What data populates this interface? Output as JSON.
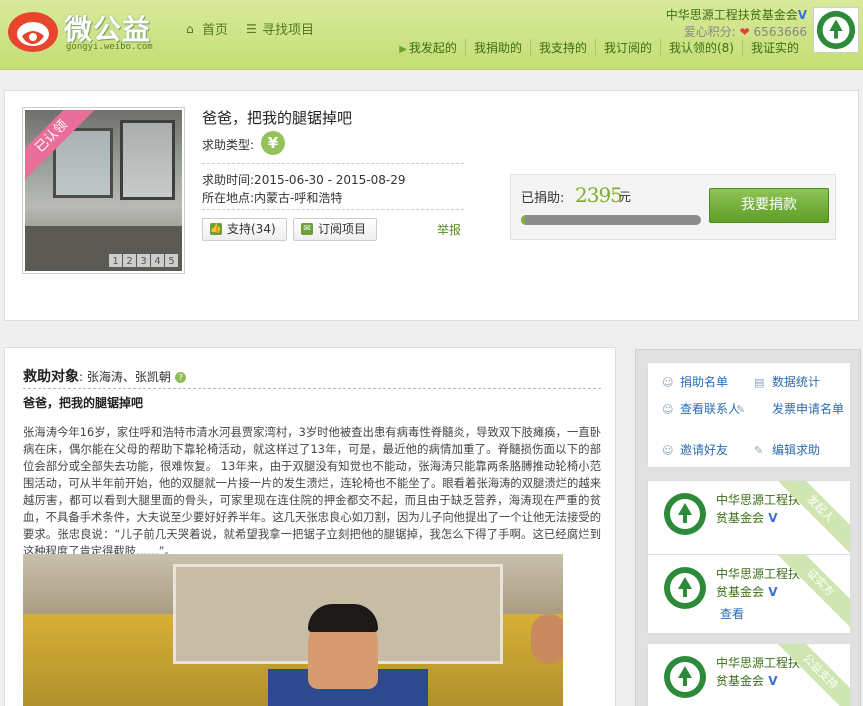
{
  "header": {
    "logo_text": "微公益",
    "logo_sub": "gongyi.weibo.com",
    "nav": [
      {
        "label": "首页",
        "icon": "home-icon"
      },
      {
        "label": "寻找项目",
        "icon": "list-icon"
      }
    ],
    "org_name": "中华思源工程扶贫基金会",
    "verified_mark": "V",
    "score_label": "爱心积分:",
    "score_value": "6563666",
    "subnav": [
      "我发起的",
      "我捐助的",
      "我支持的",
      "我订阅的",
      "我认领的(8)",
      "我证实的"
    ]
  },
  "project": {
    "ribbon": "已认领",
    "pages": [
      "1",
      "2",
      "3",
      "4",
      "5"
    ],
    "title": "爸爸，把我的腿锯掉吧",
    "category_label": "求助类型:",
    "category_icon": "¥",
    "time_label": "求助时间",
    "time_value": ":2015-06-30 - 2015-08-29",
    "place_label": "所在地点",
    "place_value": ":内蒙古-呼和浩特",
    "support_label": "支持(34)",
    "subscribe_label": "订阅项目",
    "report_label": "举报",
    "donated_label": "已捐助:",
    "donated_amount": "2395",
    "donated_unit": "元",
    "progress": 0.02,
    "donate_button": "我要捐款"
  },
  "main": {
    "rescue_label": "救助对象",
    "rescue_names": ": 张海涛、张凯朝",
    "help_icon": "?",
    "subtitle": "爸爸，把我的腿锯掉吧",
    "story": "张海涛今年16岁，家住呼和浩特市清水河县贾家湾村，3岁时他被查出患有病毒性脊髓炎，导致双下肢瘫痪，一直卧病在床，偶尔能在父母的帮助下靠轮椅活动，就这样过了13年，可是，最近他的病情加重了。脊髓损伤面以下的部位会部分或全部失去功能，很难恢复。 13年来，由于双腿没有知觉也不能动，张海涛只能靠两条胳膊推动轮椅小范围活动，可从半年前开始，他的双腿就一片接一片的发生溃烂，连轮椅也不能坐了。眼看着张海涛的双腿溃烂的越来越厉害，都可以看到大腿里面的骨头，可家里现在连住院的押金都交不起，而且由于缺乏营养，海涛现在严重的贫血，不具备手术条件，大夫说至少要好好养半年。这几天张忠良心如刀割，因为儿子向他提出了一个让他无法接受的要求。张忠良说：“儿子前几天哭着说，就希望我拿一把锯子立刻把他的腿锯掉，我怎么下得了手啊。这已经腐烂到这种程度了肯定得截肢……”。"
  },
  "sidebar": {
    "actions": [
      {
        "label": "捐助名单",
        "icon": "donors-icon"
      },
      {
        "label": "数据统计",
        "icon": "stats-icon"
      },
      {
        "label": "查看联系人",
        "icon": "contact-icon"
      },
      {
        "label": "发票申请名单",
        "icon": "invoice-icon"
      },
      {
        "label": "邀请好友",
        "icon": "invite-icon"
      },
      {
        "label": "编辑求助",
        "icon": "edit-icon"
      }
    ],
    "orgs": [
      {
        "name": "中华思源工程扶贫基金会",
        "tag": "发起人",
        "link": ""
      },
      {
        "name": "中华思源工程扶贫基金会",
        "tag": "证实方",
        "link": "查看"
      },
      {
        "name": "中华思源工程扶贫基金会",
        "tag": "公益支持",
        "link": ""
      }
    ]
  },
  "colors": {
    "header_green": "#c4de73",
    "brand_green": "#4f7a21",
    "button_green": "#5e9d28",
    "link_blue": "#2b6bb0",
    "ribbon_pink": "#e96f9a"
  }
}
